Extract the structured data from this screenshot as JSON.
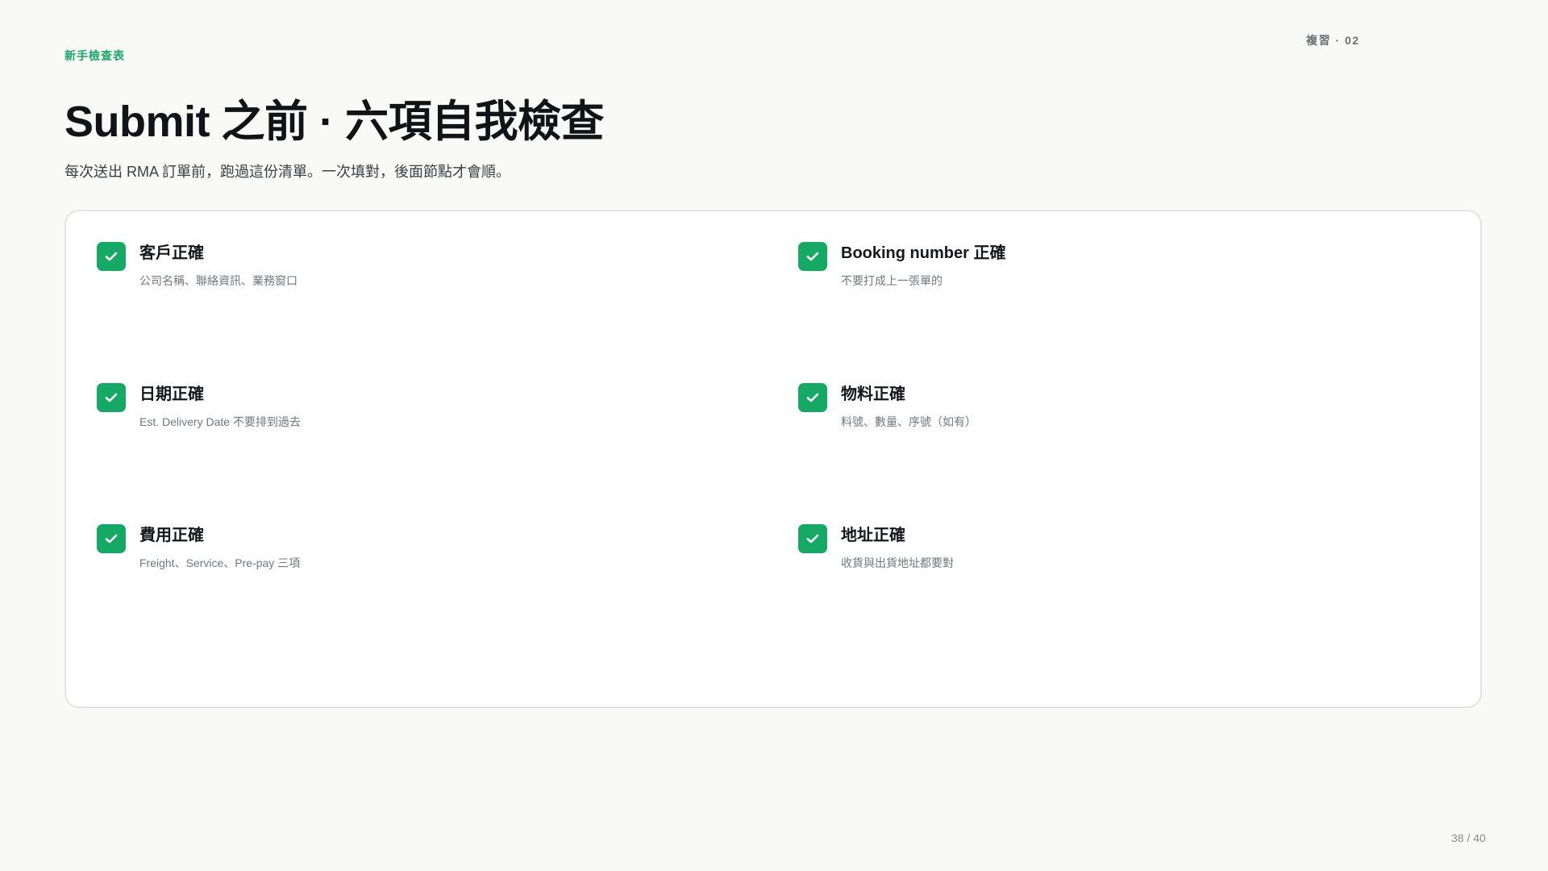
{
  "header": {
    "eyebrow": "新手檢查表",
    "corner_tag": "複習 · 02",
    "title": "Submit 之前 · 六項自我檢查",
    "subtitle": "每次送出 RMA 訂單前，跑過這份清單。一次填對，後面節點才會順。"
  },
  "checklist": {
    "items": [
      {
        "title": "客戶正確",
        "desc": "公司名稱、聯絡資訊、業務窗口",
        "checked": true,
        "icon": "check-icon"
      },
      {
        "title": "Booking number 正確",
        "desc": "不要打成上一張單的",
        "checked": true,
        "icon": "check-icon"
      },
      {
        "title": "日期正確",
        "desc": "Est. Delivery Date 不要排到過去",
        "checked": true,
        "icon": "check-icon"
      },
      {
        "title": "物料正確",
        "desc": "料號、數量、序號（如有）",
        "checked": true,
        "icon": "check-icon"
      },
      {
        "title": "費用正確",
        "desc": "Freight、Service、Pre-pay 三項",
        "checked": true,
        "icon": "check-icon"
      },
      {
        "title": "地址正確",
        "desc": "收貨與出貨地址都要對",
        "checked": true,
        "icon": "check-icon"
      }
    ]
  },
  "footer": {
    "page_number": "38 / 40"
  },
  "colors": {
    "accent": "#16a865",
    "background": "#f9f9f7",
    "card": "#ffffff",
    "text": "#15171a",
    "muted": "#72777c"
  }
}
